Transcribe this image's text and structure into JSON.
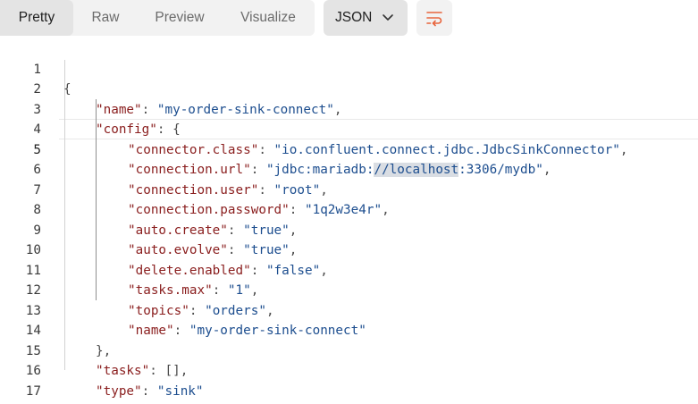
{
  "toolbar": {
    "tabs": [
      {
        "label": "Pretty",
        "active": true
      },
      {
        "label": "Raw",
        "active": false
      },
      {
        "label": "Preview",
        "active": false
      },
      {
        "label": "Visualize",
        "active": false
      }
    ],
    "format_select": {
      "value": "JSON",
      "icon": "chevron-down-icon"
    },
    "wrap_button": {
      "icon": "wrap-lines-icon",
      "color": "#e8643c"
    }
  },
  "editor": {
    "active_line": 5,
    "lines": [
      {
        "num": "1",
        "text": "{"
      },
      {
        "num": "2",
        "text": "\"name\": \"my-order-sink-connect\","
      },
      {
        "num": "3",
        "text": "\"config\": {"
      },
      {
        "num": "4",
        "text": "\"connector.class\": \"io.confluent.connect.jdbc.JdbcSinkConnector\","
      },
      {
        "num": "5",
        "text": "\"connection.url\": \"jdbc:mariadb://localhost:3306/mydb\","
      },
      {
        "num": "6",
        "text": "\"connection.user\": \"root\","
      },
      {
        "num": "7",
        "text": "\"connection.password\": \"1q2w3e4r\","
      },
      {
        "num": "8",
        "text": "\"auto.create\": \"true\","
      },
      {
        "num": "9",
        "text": "\"auto.evolve\": \"true\","
      },
      {
        "num": "10",
        "text": "\"delete.enabled\": \"false\","
      },
      {
        "num": "11",
        "text": "\"tasks.max\": \"1\","
      },
      {
        "num": "12",
        "text": "\"topics\": \"orders\","
      },
      {
        "num": "13",
        "text": "\"name\": \"my-order-sink-connect\""
      },
      {
        "num": "14",
        "text": "},"
      },
      {
        "num": "15",
        "text": "\"tasks\": [],"
      },
      {
        "num": "16",
        "text": "\"type\": \"sink\""
      },
      {
        "num": "17",
        "text": "}"
      }
    ]
  },
  "colors": {
    "json_key": "#8a1e1e",
    "json_string": "#1d4e8f",
    "selection_highlight": "#d9dde3"
  }
}
